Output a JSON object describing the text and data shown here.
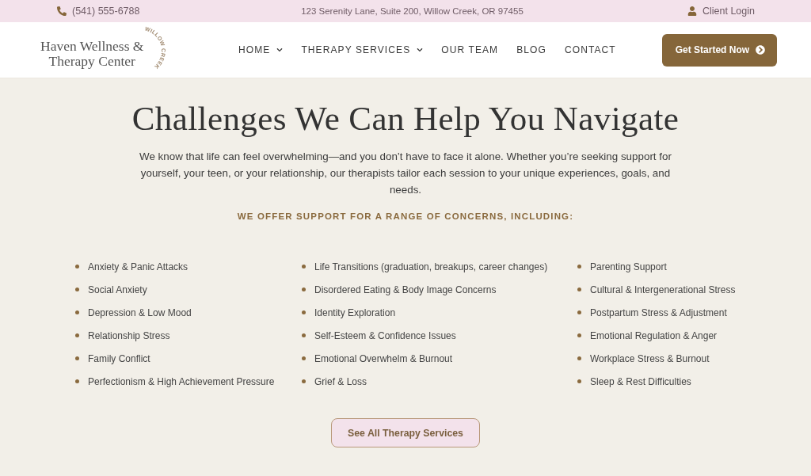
{
  "top_bar": {
    "phone": "(541) 555-6788",
    "address": "123 Serenity Lane, Suite 200, Willow Creek, OR 97455",
    "login": "Client Login"
  },
  "header": {
    "logo": {
      "lines": [
        "Haven Wellness &",
        "Therapy Center"
      ],
      "tagline": "WILLOW CREEK"
    },
    "nav": [
      {
        "label": "HOME",
        "dropdown": true
      },
      {
        "label": "THERAPY SERVICES",
        "dropdown": true
      },
      {
        "label": "OUR TEAM",
        "dropdown": false
      },
      {
        "label": "BLOG",
        "dropdown": false
      },
      {
        "label": "CONTACT",
        "dropdown": false
      }
    ],
    "cta": "Get Started Now"
  },
  "section": {
    "title": "Challenges We Can Help You Navigate",
    "intro": "We know that life can feel overwhelming—and you don’t have to face it alone. Whether you’re seeking support for yourself, your teen, or your relationship, our therapists tailor each session to your unique experiences, goals, and needs.",
    "subtitle": "WE OFFER SUPPORT FOR A RANGE OF CONCERNS, INCLUDING:",
    "columns": [
      {
        "items": [
          "Anxiety & Panic Attacks",
          "Social Anxiety",
          "Depression & Low Mood",
          "Relationship Stress",
          "Family Conflict",
          "Perfectionism & High Achievement Pressure"
        ]
      },
      {
        "items": [
          "Life Transitions (graduation, breakups, career changes)",
          "Disordered Eating & Body Image Concerns",
          "Identity Exploration",
          "Self-Esteem & Confidence Issues",
          "Emotional Overwhelm & Burnout",
          "Grief & Loss"
        ]
      },
      {
        "items": [
          "Parenting Support",
          "Cultural & Intergenerational Stress",
          "Postpartum Stress & Adjustment",
          "Emotional Regulation & Anger",
          "Workplace Stress & Burnout",
          "Sleep & Rest Difficulties"
        ]
      }
    ],
    "button": "See All Therapy Services"
  }
}
